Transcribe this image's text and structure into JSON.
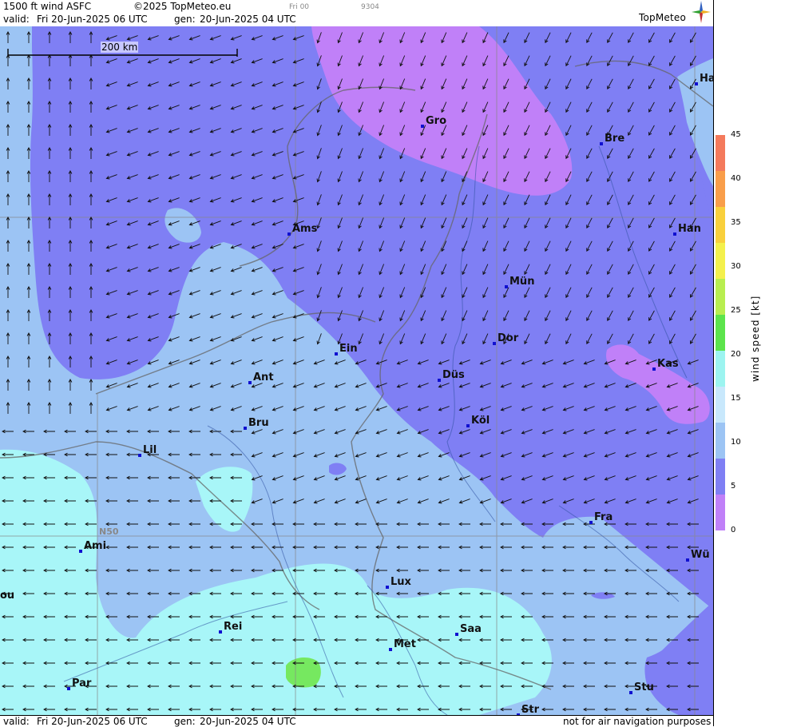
{
  "header": {
    "product": "1500 ft wind ASFC",
    "copyright": "©2025 TopMeteo.eu",
    "run_tag": "Fri 00",
    "code": "9304",
    "valid_label": "valid:",
    "valid_value": "Fri  20-Jun-2025  06 UTC",
    "gen_label": "gen:",
    "gen_value": "20-Jun-2025 04 UTC",
    "logo_text": "TopMeteo"
  },
  "footer": {
    "valid_label": "valid:",
    "valid_value": "Fri  20-Jun-2025  06 UTC",
    "gen_label": "gen:",
    "gen_value": "20-Jun-2025 04 UTC",
    "disclaimer": "not for air navigation purposes"
  },
  "map": {
    "scale_label": "200 km",
    "lat_label": "N50",
    "cities": [
      {
        "name": "Gro"
      },
      {
        "name": "Bre"
      },
      {
        "name": "Ha"
      },
      {
        "name": "Ams"
      },
      {
        "name": "Han"
      },
      {
        "name": "Mün"
      },
      {
        "name": "Ein"
      },
      {
        "name": "Dor"
      },
      {
        "name": "Kas"
      },
      {
        "name": "Ant"
      },
      {
        "name": "Düs"
      },
      {
        "name": "Bru"
      },
      {
        "name": "Köl"
      },
      {
        "name": "Lil"
      },
      {
        "name": "Fra"
      },
      {
        "name": "Ami"
      },
      {
        "name": "Wü"
      },
      {
        "name": "Lux"
      },
      {
        "name": "ou"
      },
      {
        "name": "Rei"
      },
      {
        "name": "Saa"
      },
      {
        "name": "Met"
      },
      {
        "name": "Stu"
      },
      {
        "name": "Par"
      },
      {
        "name": "Str"
      }
    ]
  },
  "legend": {
    "title": "wind  speed  [kt]",
    "ticks": [
      "45",
      "40",
      "35",
      "30",
      "25",
      "20",
      "15",
      "10",
      "5",
      "0"
    ],
    "colors": [
      "#f47a5c",
      "#f99e4a",
      "#f9d03c",
      "#f4f04c",
      "#b8ee50",
      "#5ce44c",
      "#9cf4f0",
      "#c8e8fc",
      "#9cc4f4",
      "#7f7ff4",
      "#c080f8"
    ]
  }
}
